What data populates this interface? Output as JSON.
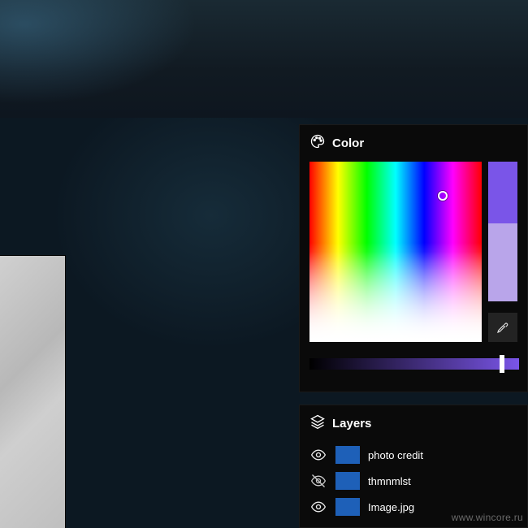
{
  "panels": {
    "color": {
      "title": "Color"
    },
    "layers": {
      "title": "Layers"
    }
  },
  "color_picker": {
    "slider_value": 0.91,
    "primary_swatch": "#7a55e8",
    "secondary_swatch": "#b9a5ea"
  },
  "layers": [
    {
      "name": "photo credit",
      "visible": true,
      "thumb": "#1e60b8"
    },
    {
      "name": "thmnmlst",
      "visible": false,
      "thumb": "#1e60b8"
    },
    {
      "name": "Image.jpg",
      "visible": true,
      "thumb": "#1e60b8"
    }
  ],
  "watermark": "www.wincore.ru"
}
